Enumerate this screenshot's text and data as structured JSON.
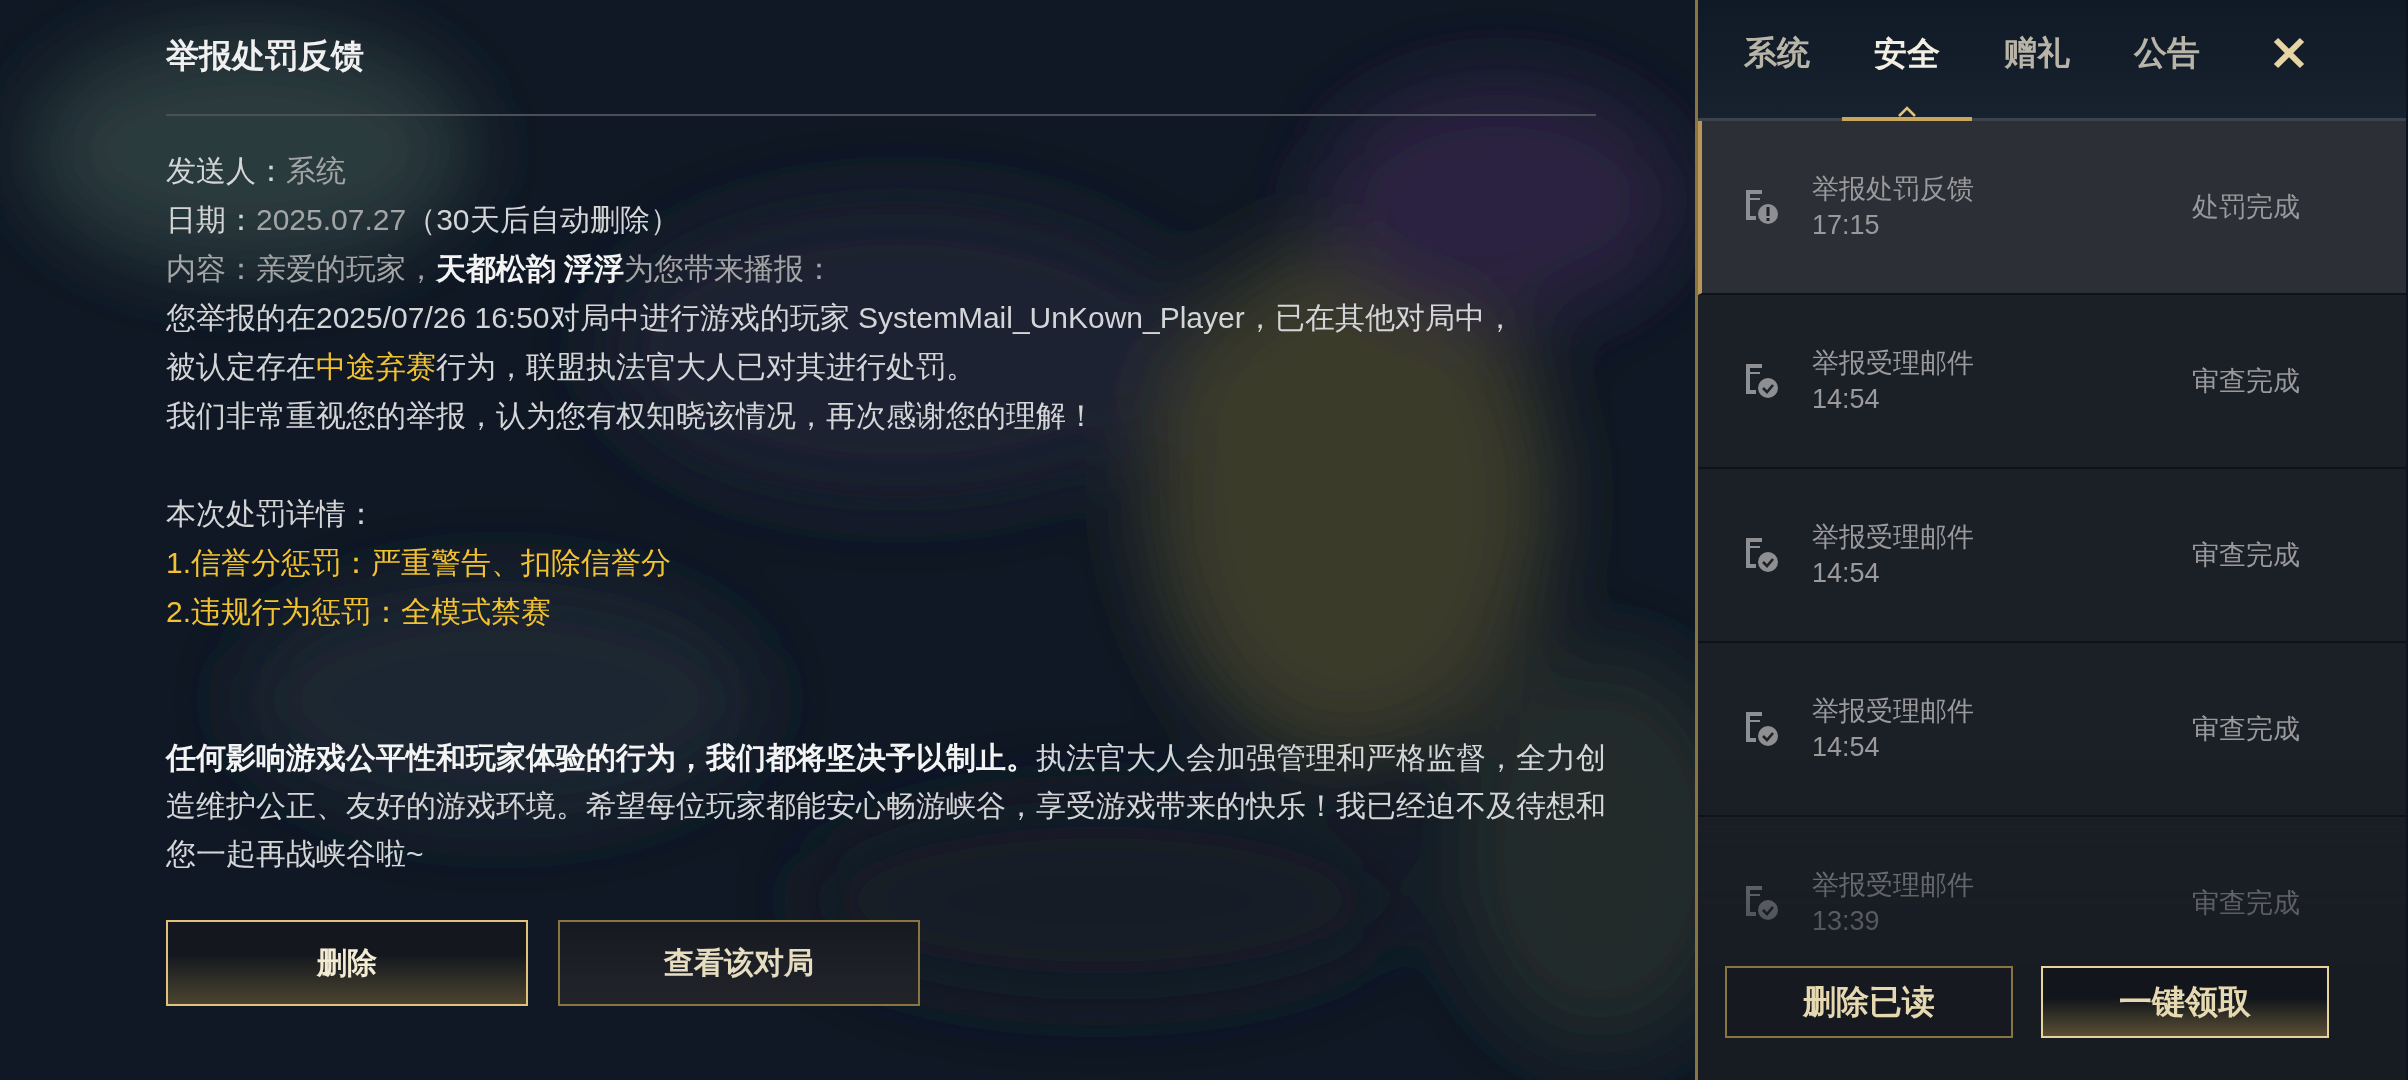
{
  "mail": {
    "title": "举报处罚反馈",
    "lines": [
      {
        "segments": [
          {
            "text": "发送人：",
            "dimmed": false,
            "emphasized": false,
            "highlighted": false
          },
          {
            "text": "系统",
            "dimmed": true,
            "emphasized": false,
            "highlighted": false
          }
        ]
      },
      {
        "segments": [
          {
            "text": "日期：",
            "dimmed": false,
            "emphasized": false,
            "highlighted": false
          },
          {
            "text": "2025.07.27",
            "dimmed": true,
            "emphasized": false,
            "highlighted": false
          },
          {
            "text": "（30天后自动删除）",
            "dimmed": false,
            "emphasized": false,
            "highlighted": false
          }
        ]
      },
      {
        "segments": [
          {
            "text": "内容：亲爱的玩家，",
            "dimmed": true,
            "emphasized": false,
            "highlighted": false
          },
          {
            "text": "天都松韵 浮浮",
            "dimmed": false,
            "emphasized": true,
            "highlighted": false
          },
          {
            "text": "为您带来播报：",
            "dimmed": true,
            "emphasized": false,
            "highlighted": false
          }
        ]
      },
      {
        "segments": [
          {
            "text": "您举报的在2025/07/26 16:50对局中进行游戏的玩家 SystemMail_UnKown_Player，已在其他对局中，",
            "dimmed": false,
            "emphasized": false,
            "highlighted": false
          }
        ]
      },
      {
        "segments": [
          {
            "text": "被认定存在",
            "dimmed": false,
            "emphasized": false,
            "highlighted": false
          },
          {
            "text": "中途弃赛",
            "dimmed": false,
            "emphasized": false,
            "highlighted": true
          },
          {
            "text": "行为，联盟执法官大人已对其进行处罚。",
            "dimmed": false,
            "emphasized": false,
            "highlighted": false
          }
        ]
      },
      {
        "segments": [
          {
            "text": "我们非常重视您的举报，认为您有权知晓该情况，再次感谢您的理解！",
            "dimmed": false,
            "emphasized": false,
            "highlighted": false
          }
        ]
      }
    ],
    "penalty": {
      "heading": "本次处罚详情：",
      "items": [
        "1.信誉分惩罚：严重警告、扣除信誉分",
        "2.违规行为惩罚：全模式禁赛"
      ]
    },
    "closing": [
      {
        "text": "任何影响游戏公平性和玩家体验的行为，我们都将坚决予以制止。",
        "dimmed": false,
        "emphasized": true,
        "highlighted": false
      },
      {
        "text": "执法官大人会加强管理和严格监督，全力创造维护公正、友好的游戏环境。希望每位玩家都能安心畅游峡谷，享受游戏带来的快乐！我已经迫不及待想和您一起再战峡谷啦~",
        "dimmed": false,
        "emphasized": false,
        "highlighted": false
      }
    ],
    "buttons": [
      {
        "label": "删除",
        "primary": true
      },
      {
        "label": "查看该对局",
        "primary": false
      }
    ]
  },
  "sidebar": {
    "tabs": [
      {
        "label": "系统",
        "selected": false
      },
      {
        "label": "安全",
        "selected": true
      },
      {
        "label": "赠礼",
        "selected": false
      },
      {
        "label": "公告",
        "selected": false
      }
    ],
    "items": [
      {
        "kind": "alert",
        "title": "举报处罚反馈",
        "time": "17:15",
        "status": "处罚完成",
        "selected": true
      },
      {
        "kind": "check",
        "title": "举报受理邮件",
        "time": "14:54",
        "status": "审查完成",
        "selected": false
      },
      {
        "kind": "check",
        "title": "举报受理邮件",
        "time": "14:54",
        "status": "审查完成",
        "selected": false
      },
      {
        "kind": "check",
        "title": "举报受理邮件",
        "time": "14:54",
        "status": "审查完成",
        "selected": false
      },
      {
        "kind": "check",
        "title": "举报受理邮件",
        "time": "13:39",
        "status": "审查完成",
        "selected": false
      }
    ],
    "buttons": [
      {
        "label": "删除已读",
        "primary": false
      },
      {
        "label": "一键领取",
        "primary": true
      }
    ]
  }
}
